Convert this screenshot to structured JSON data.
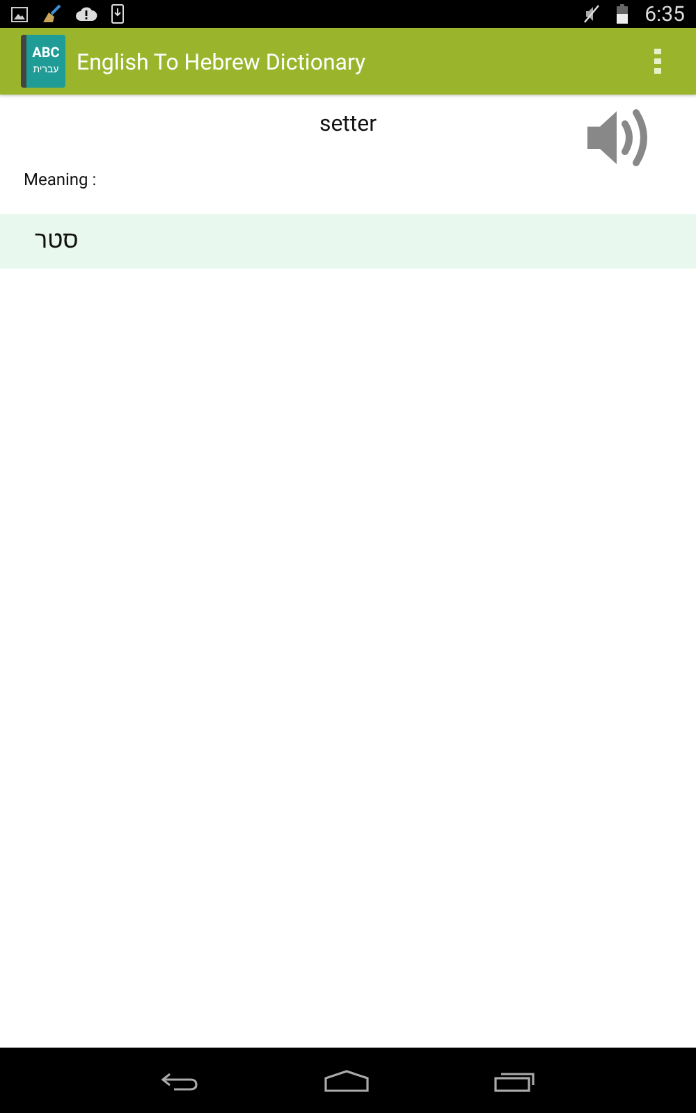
{
  "status_bar": {
    "time": "6:35"
  },
  "app_bar": {
    "logo_top": "ABC",
    "logo_bottom": "עברית",
    "title": "English To Hebrew Dictionary"
  },
  "word": "setter",
  "meaning_label": "Meaning :",
  "meanings": [
    "סטר"
  ]
}
